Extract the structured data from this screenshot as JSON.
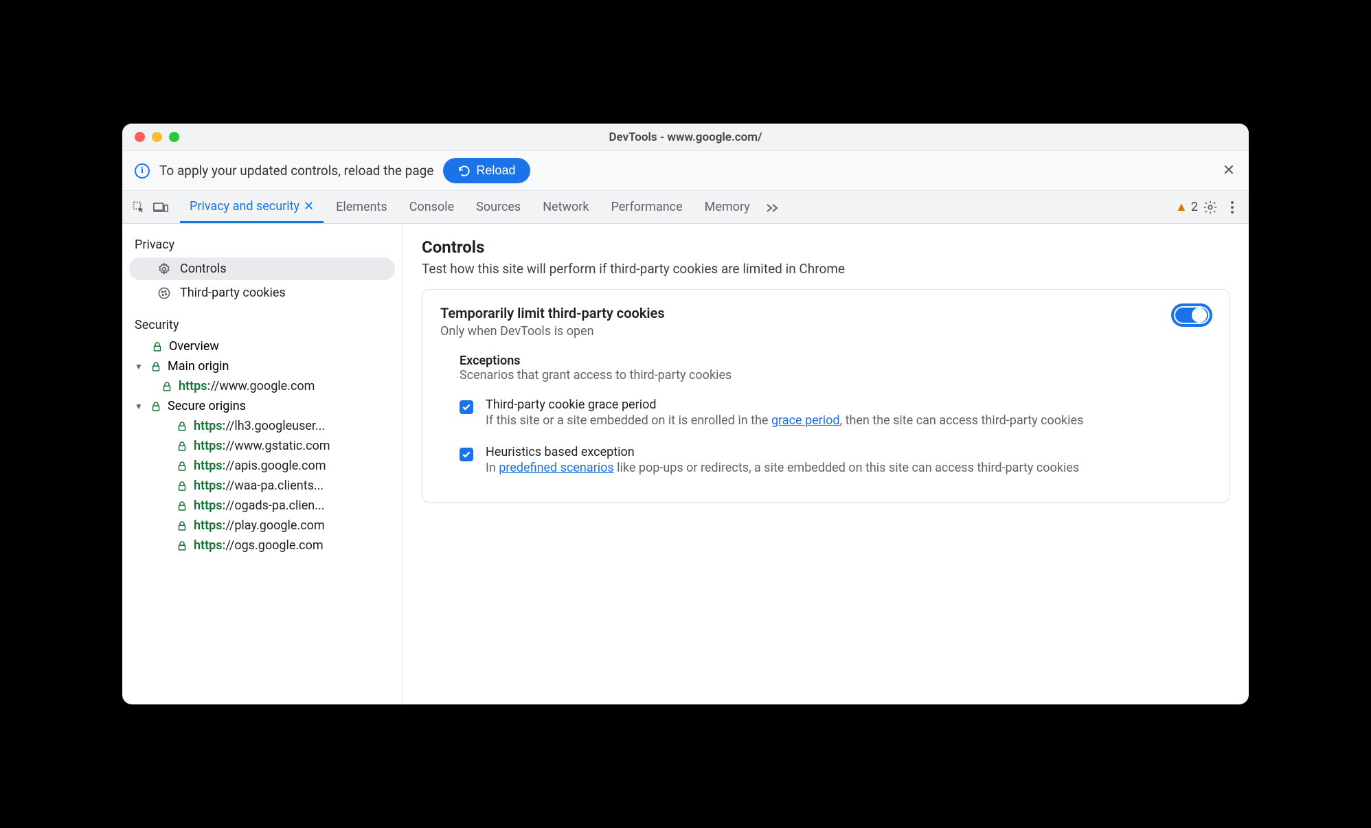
{
  "window": {
    "title": "DevTools - www.google.com/"
  },
  "infobar": {
    "text": "To apply your updated controls, reload the page",
    "reload_label": "Reload"
  },
  "warn_count": "2",
  "tabs": [
    {
      "label": "Privacy and security",
      "closable": true,
      "active": true
    },
    {
      "label": "Elements"
    },
    {
      "label": "Console"
    },
    {
      "label": "Sources"
    },
    {
      "label": "Network"
    },
    {
      "label": "Performance"
    },
    {
      "label": "Memory"
    }
  ],
  "sidebar": {
    "privacy_heading": "Privacy",
    "controls_label": "Controls",
    "third_party_label": "Third-party cookies",
    "security_heading": "Security",
    "overview_label": "Overview",
    "main_origin_label": "Main origin",
    "main_origin": {
      "scheme": "https:",
      "host": "//www.google.com"
    },
    "secure_origins_label": "Secure origins",
    "origins": [
      {
        "scheme": "https:",
        "host": "//lh3.googleuser..."
      },
      {
        "scheme": "https:",
        "host": "//www.gstatic.com"
      },
      {
        "scheme": "https:",
        "host": "//apis.google.com"
      },
      {
        "scheme": "https:",
        "host": "//waa-pa.clients..."
      },
      {
        "scheme": "https:",
        "host": "//ogads-pa.clien..."
      },
      {
        "scheme": "https:",
        "host": "//play.google.com"
      },
      {
        "scheme": "https:",
        "host": "//ogs.google.com"
      }
    ]
  },
  "main": {
    "heading": "Controls",
    "subtitle": "Test how this site will perform if third-party cookies are limited in Chrome",
    "card_title": "Temporarily limit third-party cookies",
    "card_sub": "Only when DevTools is open",
    "exceptions_heading": "Exceptions",
    "exceptions_sub": "Scenarios that grant access to third-party cookies",
    "exc1_title": "Third-party cookie grace period",
    "exc1_pre": "If this site or a site embedded on it is enrolled in the ",
    "exc1_link": "grace period",
    "exc1_post": ", then the site can access third-party cookies",
    "exc2_title": "Heuristics based exception",
    "exc2_pre": "In ",
    "exc2_link": "predefined scenarios",
    "exc2_post": " like pop-ups or redirects, a site embedded on this site can access third-party cookies"
  }
}
